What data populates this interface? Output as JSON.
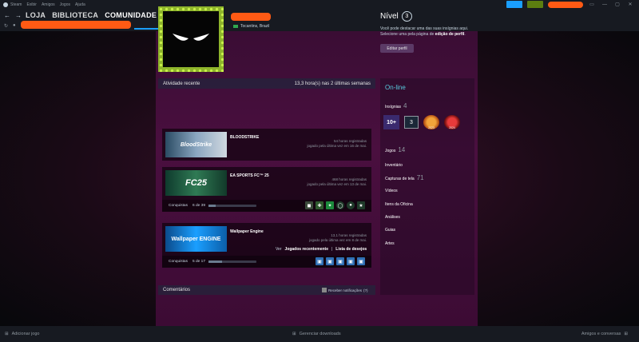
{
  "titlebar": {
    "menu": [
      "Steam",
      "Exibir",
      "Amigos",
      "Jogos",
      "Ajuda"
    ],
    "controls": [
      "▭",
      "—",
      "▢",
      "✕"
    ]
  },
  "nav": {
    "links": [
      "LOJA",
      "BIBLIOTECA",
      "COMUNIDADE"
    ]
  },
  "profile": {
    "location": "Tocantins, Brazil",
    "level_label": "Nível",
    "level": "3",
    "level_desc_1": "Você pode destacar uma das suas insígnias aqui. Selecione uma pela página de",
    "level_desc_link": "edição de perfil",
    "level_desc_end": ".",
    "edit_button": "Editar perfil"
  },
  "activity": {
    "title": "Atividade recente",
    "summary": "13,3 hora(s) nas 2 últimas semanas",
    "achievements_label": "Conquistas",
    "games": [
      {
        "name": "BLOODSTRIKE",
        "thumb_text": "BloodStrike",
        "hours": "54 horas registradas",
        "last": "jogado pela última vez em 16 de mai.",
        "ach": ""
      },
      {
        "name": "EA SPORTS FC™ 25",
        "thumb_text": "FC25",
        "hours": "468 horas registradas",
        "last": "jogado pela última vez em 13 de mai.",
        "ach": "6 de 39",
        "progress": 0.15
      },
      {
        "name": "Wallpaper Engine",
        "thumb_text": "Wallpaper ENGINE",
        "hours": "13,1 horas registradas",
        "last": "jogado pela última vez em 8 de mai.",
        "ach": "5 de 17",
        "progress": 0.29
      }
    ],
    "footer_prefix": "Ver",
    "footer_recent": "Jogados recentemente",
    "footer_sep": "|",
    "footer_wishlist": "Lista de desejos"
  },
  "comments": {
    "title": "Comentários",
    "notify": "Receber notificações",
    "notify_suffix": "(?)"
  },
  "sidebar": {
    "status": "On-line",
    "badges_label": "Insígnias",
    "badges_count": "4",
    "badges": [
      "10+",
      "3",
      "2023",
      "2024"
    ],
    "games_label": "Jogos",
    "games_count": "14",
    "inventory": "Inventário",
    "screenshots_label": "Capturas de tela",
    "screenshots_count": "71",
    "videos": "Vídeos",
    "workshop": "Itens da Oficina",
    "reviews": "Análises",
    "guides": "Guias",
    "artwork": "Artes"
  },
  "bottombar": {
    "add_game": "Adicionar jogo",
    "downloads": "Gerenciar downloads",
    "friends": "Amigos e conversas"
  },
  "colors": {
    "accent": "#1a9fff",
    "online": "#57cbde",
    "redaction": "#ff5a14"
  }
}
